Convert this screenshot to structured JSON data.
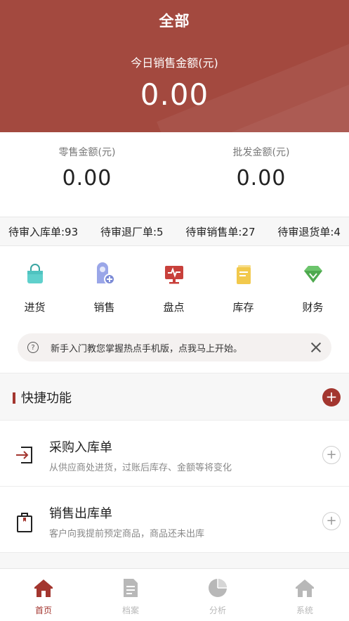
{
  "header": {
    "title": "全部",
    "today_label": "今日销售金额(元)",
    "today_value": "0.00"
  },
  "amounts": {
    "retail_label": "零售金额(元)",
    "retail_value": "0.00",
    "wholesale_label": "批发金额(元)",
    "wholesale_value": "0.00"
  },
  "pending": [
    "待审入库单:93",
    "待审退厂单:5",
    "待审销售单:27",
    "待审退货单:4"
  ],
  "menu": [
    {
      "label": "进货",
      "icon": "shopping-bag-icon",
      "color": "#4fc3c0"
    },
    {
      "label": "销售",
      "icon": "user-add-icon",
      "color": "#7b8ad6"
    },
    {
      "label": "盘点",
      "icon": "monitor-pulse-icon",
      "color": "#c8403b"
    },
    {
      "label": "库存",
      "icon": "document-stack-icon",
      "color": "#f2c94c"
    },
    {
      "label": "财务",
      "icon": "diamond-icon",
      "color": "#5cb85c"
    }
  ],
  "tip": {
    "text": "新手入门教您掌握热点手机版，点我马上开始。"
  },
  "quick": {
    "title": "快捷功能",
    "items": [
      {
        "name": "采购入库单",
        "desc": "从供应商处进货，过账后库存、金额等将变化",
        "icon": "import-box-icon"
      },
      {
        "name": "销售出库单",
        "desc": "客户向我提前预定商品，商品还未出库",
        "icon": "clipboard-bag-icon"
      }
    ]
  },
  "tabs": [
    {
      "label": "首页",
      "icon": "home-icon",
      "active": true
    },
    {
      "label": "档案",
      "icon": "file-icon",
      "active": false
    },
    {
      "label": "分析",
      "icon": "pie-chart-icon",
      "active": false
    },
    {
      "label": "系统",
      "icon": "system-home-icon",
      "active": false
    }
  ],
  "colors": {
    "brand": "#a3493f",
    "accent": "#a3362f"
  }
}
